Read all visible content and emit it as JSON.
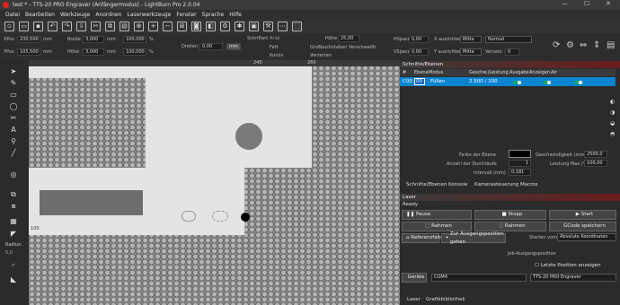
{
  "window": {
    "title": "test * - TTS-20 PRO Engraver (Anfängermodus) - LightBurn Pro 2.0.04"
  },
  "menu": [
    "Datei",
    "Bearbeiten",
    "Werkzeuge",
    "Anordnen",
    "Laserwerkzeuge",
    "Fenster",
    "Sprache",
    "Hilfe"
  ],
  "props": {
    "xpos_label": "XPos",
    "xpos": "230,500",
    "ypos_label": "YPos",
    "ypos": "105,500",
    "width_label": "Breite",
    "width": "3,000",
    "height_label": "Höhe",
    "height": "3,000",
    "unit": "mm",
    "pct1": "100,000",
    "pct2": "100,000",
    "pct_sym": "%",
    "rotate_label": "Drehen",
    "rotate": "0,00",
    "font_label": "Schriftart",
    "font": "Arial",
    "height2_label": "Höhe",
    "height2": "25,00",
    "bold": "Fett",
    "italic": "Kursiv",
    "caps": "Großbuchstaben",
    "distort": "Verzerren",
    "welded": "Verschweißt",
    "hspace_label": "HSpace",
    "hspace": "0,00",
    "vspace_label": "VSpace",
    "vspace": "0,00",
    "xalign_label": "X ausrichten",
    "xalign": "Mitte",
    "yalign_label": "Y ausrichten",
    "yalign": "Mitte",
    "normal": "Normal",
    "offset_label": "Versatz",
    "offset": "0"
  },
  "ruler": {
    "t1": "240",
    "t2": "260",
    "left": "100"
  },
  "sidebar": {
    "radius_label": "Radius:",
    "radius": "5,0"
  },
  "cuts": {
    "header": "Schnitte/Ebenen",
    "cols": [
      "#",
      "Ebene",
      "Modus",
      "Geschw./Leistung",
      "Ausgabe",
      "Anzeigen",
      "Air"
    ],
    "row": {
      "num": "C00",
      "layer": "00",
      "mode": "Füllen",
      "speed": "2.500 / 100"
    },
    "color_label": "Farbe der Ebene",
    "speed_label": "Geschwindigkeit (mm/m)",
    "speed": "2500,0",
    "passes_label": "Anzahl der Durchläufe",
    "passes": "1",
    "power_label": "Leistung Max (%)",
    "power": "100,00",
    "interval_label": "Intervall (mm)",
    "interval": "0,181"
  },
  "tabs1": [
    "Schnitte/Ebenen",
    "Konsole",
    "Kamerasteuerung",
    "Macros"
  ],
  "laser": {
    "header": "Laser",
    "status": "Ready",
    "pause": "Pause",
    "stop": "Stopp",
    "start": "Start",
    "frame1": "Rahmen",
    "frame2": "Rahmen",
    "save_gcode": "GCode speichern",
    "ref": "Referenzfahrt",
    "goto_origin": "Zur Ausgangsposition gehen",
    "start_from_label": "Starten vom:",
    "start_from": "Absolute Koordinaten",
    "job_origin": "Job-Ausgangsposition",
    "last_pos": "Letzte Position anzeigen",
    "devices": "Geräte",
    "port": "COM4",
    "machine": "TTS-20 PRO Engraver"
  },
  "tabs2": [
    "Laser",
    "Grafikbibliothek"
  ],
  "colors": {
    "accent": "#0a84d0",
    "layer": "#1565c0"
  }
}
